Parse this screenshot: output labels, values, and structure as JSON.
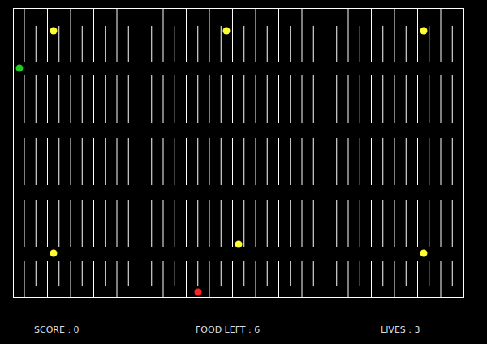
{
  "hud": [
    {
      "label": "SCORE : 0"
    },
    {
      "label": "FOOD LEFT : 6"
    },
    {
      "label": "LIVES : 3"
    }
  ],
  "food": [
    {
      "color": "#ffff33"
    },
    {
      "color": "#ffff33"
    },
    {
      "color": "#ffff33"
    },
    {
      "color": "#ffff33"
    },
    {
      "color": "#ffff33"
    },
    {
      "color": "#ffff33"
    }
  ],
  "player": {
    "color": "#22cc22"
  },
  "enemy": {
    "color": "#ff2222"
  }
}
